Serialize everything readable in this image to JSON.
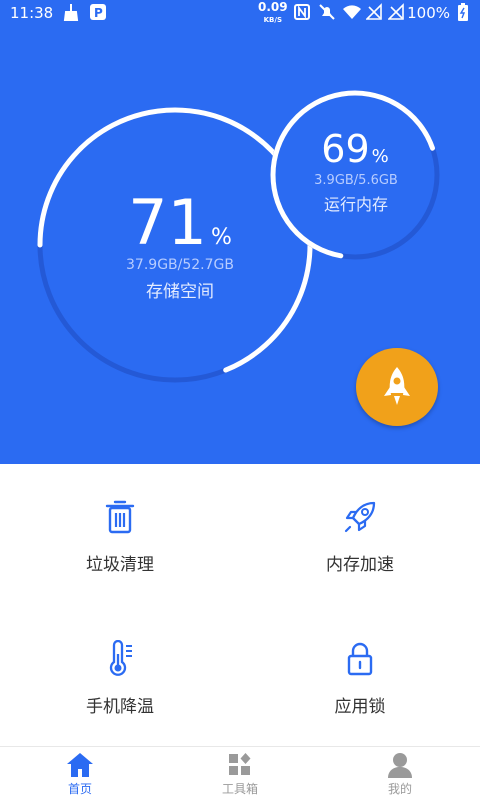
{
  "status_bar": {
    "time": "11:38",
    "net_speed_value": "0.09",
    "net_speed_unit": "KB/S",
    "battery": "100%"
  },
  "storage": {
    "percent": "71",
    "percent_value": 71,
    "unit": "%",
    "usage": "37.9GB/52.7GB",
    "label": "存储空间"
  },
  "memory": {
    "percent": "69",
    "percent_value": 69,
    "unit": "%",
    "usage": "3.9GB/5.6GB",
    "label": "运行内存"
  },
  "boost_button": {
    "icon": "rocket-icon"
  },
  "tools": [
    {
      "label": "垃圾清理",
      "icon": "trash-icon"
    },
    {
      "label": "内存加速",
      "icon": "rocket-icon"
    },
    {
      "label": "手机降温",
      "icon": "thermometer-icon"
    },
    {
      "label": "应用锁",
      "icon": "lock-icon"
    }
  ],
  "bottom_nav": [
    {
      "label": "首页",
      "icon": "home-icon",
      "active": true
    },
    {
      "label": "工具箱",
      "icon": "toolbox-icon",
      "active": false
    },
    {
      "label": "我的",
      "icon": "user-icon",
      "active": false
    }
  ],
  "colors": {
    "primary": "#2b6bf2",
    "accent": "#f1a11a",
    "active_nav": "#2b6bf2",
    "inactive_nav": "#9a9a9a"
  }
}
